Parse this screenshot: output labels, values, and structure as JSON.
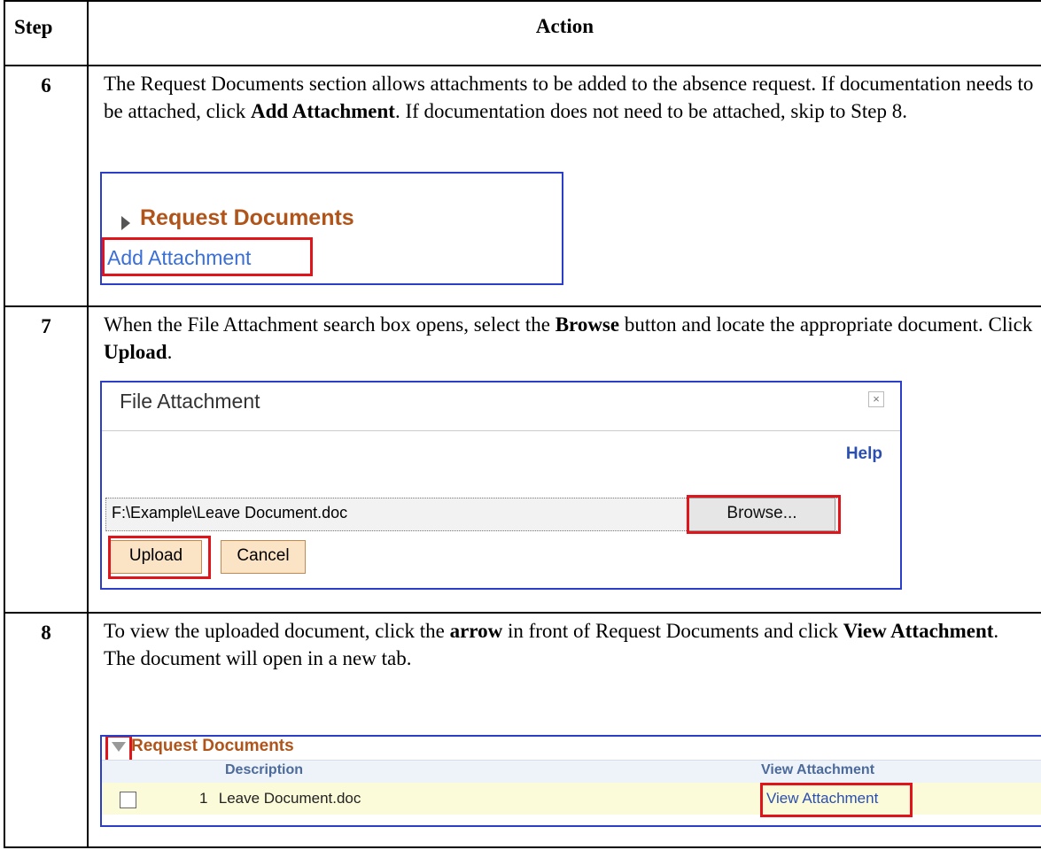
{
  "table": {
    "header_step": "Step",
    "header_action": "Action"
  },
  "rows": [
    {
      "step": "6",
      "text_parts": [
        "The Request Documents section allows attachments to be added to the absence request.  If documentation needs to be attached, click ",
        "Add Attachment",
        ".  If documentation does not need to be attached, skip to Step 8."
      ]
    },
    {
      "step": "7",
      "text_parts": [
        "When the File Attachment search box opens, select the ",
        "Browse",
        " button and locate the appropriate document.  Click ",
        "Upload",
        "."
      ]
    },
    {
      "step": "8",
      "text_parts": [
        "To view the uploaded document, click the ",
        "arrow",
        " in front of Request Documents and click ",
        "View Attachment",
        ".  The document will open in a new tab."
      ]
    }
  ],
  "panel1": {
    "title": "Request Documents",
    "add_link": "Add Attachment"
  },
  "panel2": {
    "title": "File Attachment",
    "close": "×",
    "help": "Help",
    "path_value": "F:\\Example\\Leave Document.doc",
    "browse_label": "Browse...",
    "upload_label": "Upload",
    "cancel_label": "Cancel"
  },
  "panel3": {
    "title": "Request Documents",
    "col_description": "Description",
    "col_view": "View Attachment",
    "row": {
      "number": "1",
      "description": "Leave Document.doc",
      "view_link": "View Attachment"
    }
  },
  "colors": {
    "highlight": "#e0151b",
    "panel_border": "#2b3ec9",
    "section_title": "#b0541a",
    "link": "#3a6fd6"
  }
}
